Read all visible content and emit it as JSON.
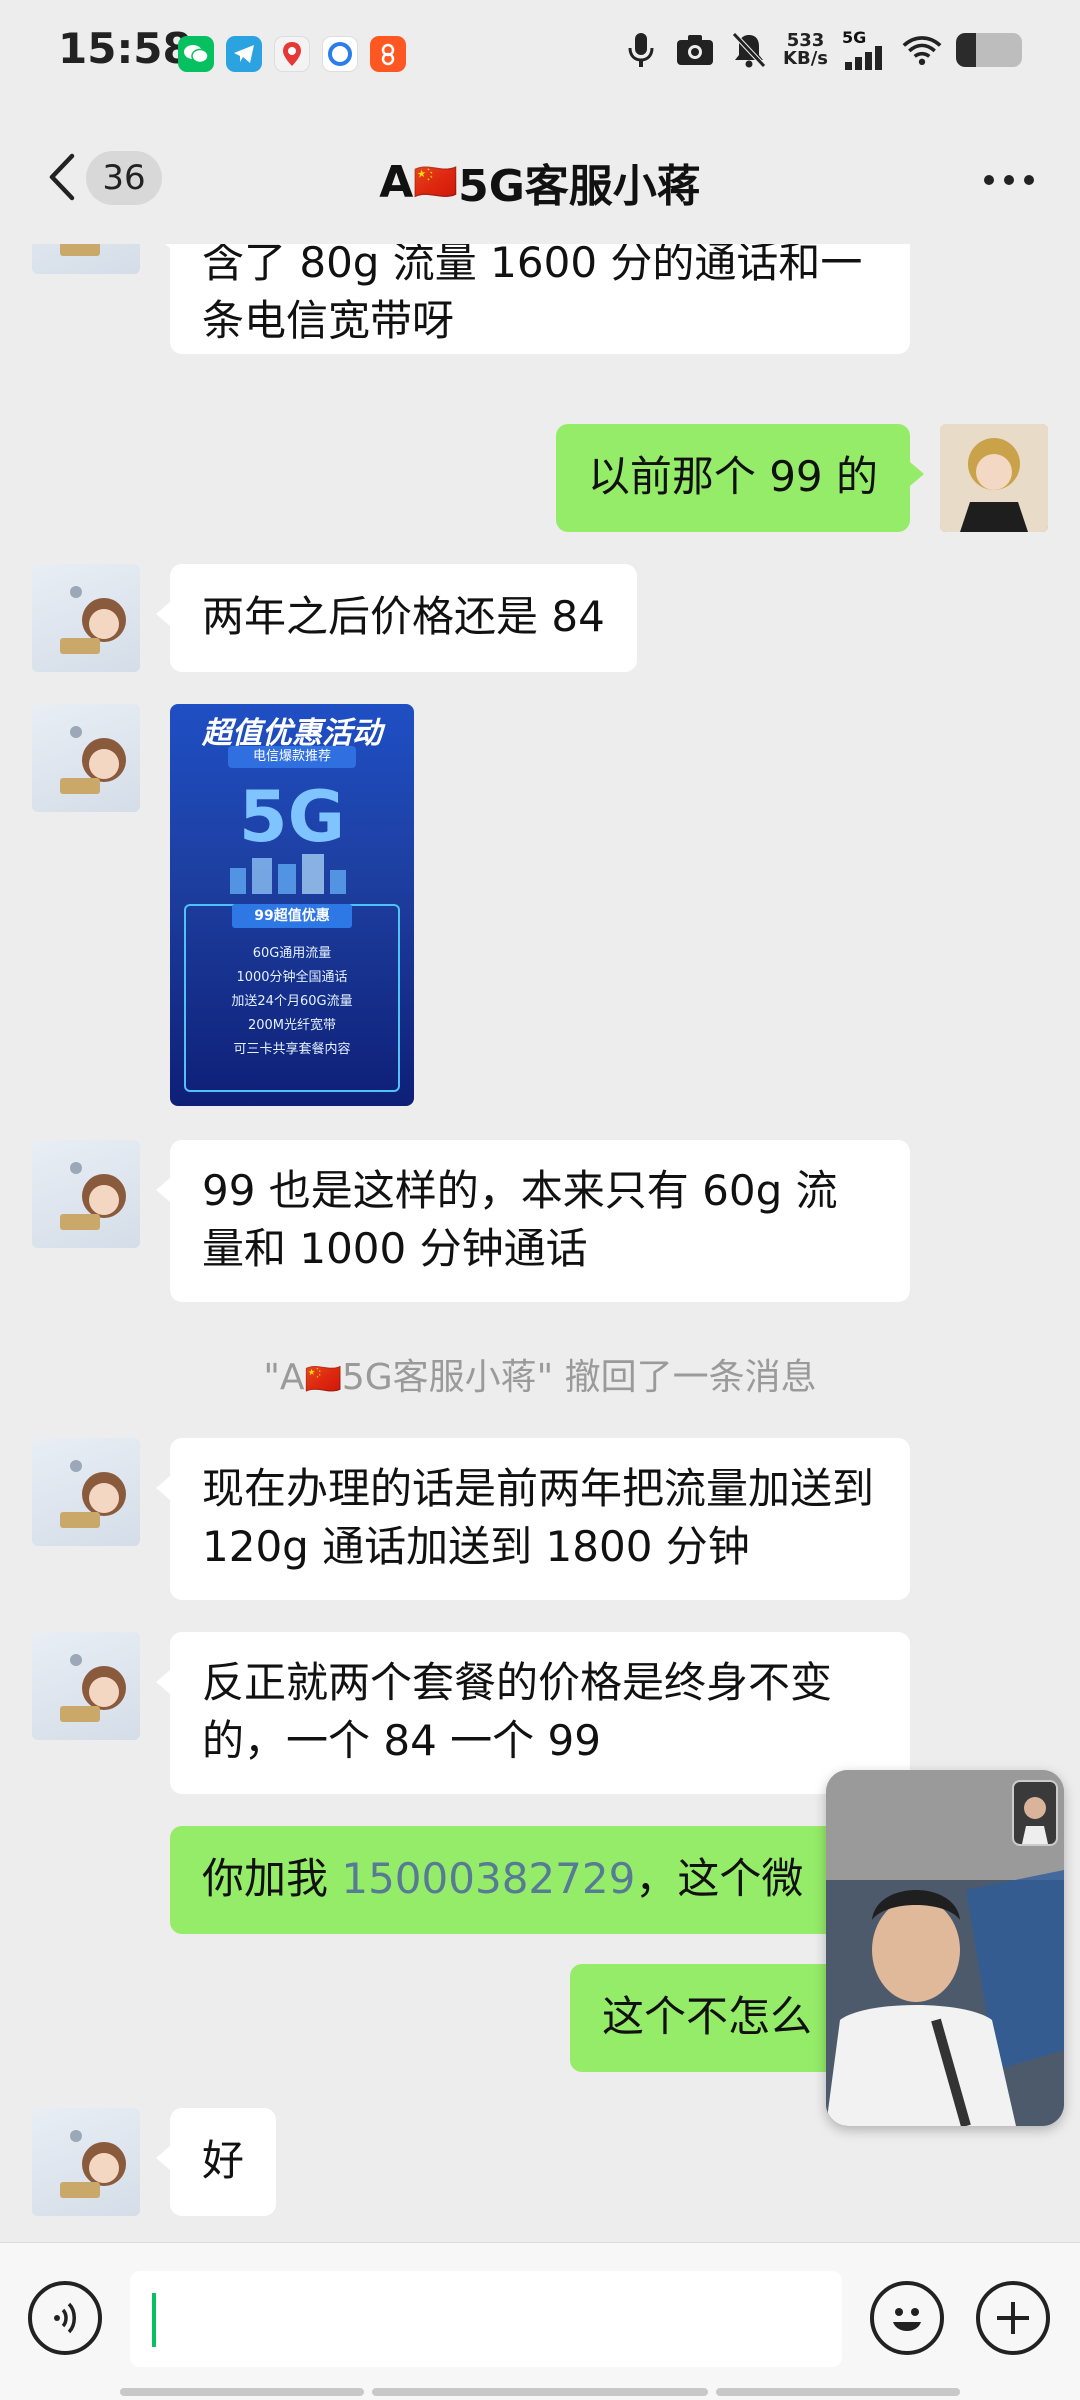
{
  "status_bar": {
    "time": "15:58",
    "net_speed_value": "533",
    "net_speed_unit": "KB/s",
    "network_type": "5G",
    "battery_level": 0.3,
    "notification_icons": [
      "wechat-icon",
      "telegram-icon",
      "baidu-maps-icon",
      "browser-icon",
      "app-icon"
    ]
  },
  "nav": {
    "unread_count": "36",
    "title_prefix": "A",
    "title_flag": "🇨🇳",
    "title_suffix": "5G客服小蒋"
  },
  "messages": [
    {
      "side": "in",
      "text": "含了 80g 流量 1600 分的通话和一条电信宽带呀"
    },
    {
      "side": "out",
      "text": "以前那个 99 的"
    },
    {
      "side": "in",
      "text": "两年之后价格还是 84"
    },
    {
      "side": "in",
      "type": "image",
      "image": {
        "headline": "超值优惠活动",
        "tagline": "电信爆款推荐",
        "big_text": "5G",
        "panel_title": "99超值优惠",
        "features": [
          "60G通用流量",
          "1000分钟全国通话",
          "加送24个月60G流量",
          "200M光纤宽带",
          "可三卡共享套餐内容"
        ]
      }
    },
    {
      "side": "in",
      "text": "99 也是这样的，本来只有 60g 流量和 1000 分钟通话"
    },
    {
      "type": "system",
      "prefix": "\"A",
      "flag": "🇨🇳",
      "suffix": "5G客服小蒋\" 撤回了一条消息"
    },
    {
      "side": "in",
      "text": "现在办理的话是前两年把流量加送到 120g 通话加送到 1800 分钟"
    },
    {
      "side": "in",
      "text": "反正就两个套餐的价格是终身不变的，一个 84 一个 99"
    },
    {
      "side": "out",
      "text_before": "你加我 ",
      "phone": "15000382729",
      "text_after": "，这个微"
    },
    {
      "side": "out",
      "text": "这个不怎么"
    },
    {
      "side": "in",
      "text": "好"
    }
  ],
  "colors": {
    "outgoing_bubble": "#95ec69",
    "incoming_bubble": "#ffffff",
    "background": "#ededed",
    "link": "#577a95",
    "caret": "#07c160"
  }
}
